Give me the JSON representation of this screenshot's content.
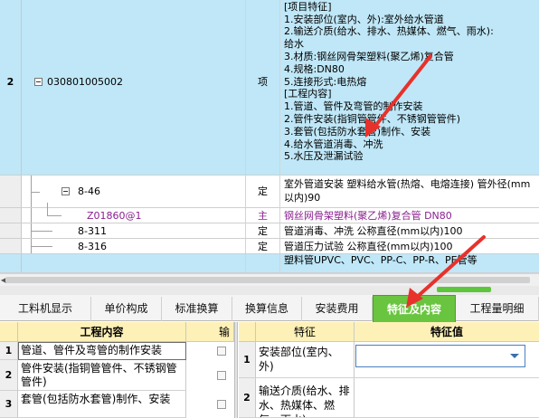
{
  "grid": {
    "main_row": {
      "num": "2",
      "code": "030801005002",
      "unit": "项",
      "desc_lines": [
        "塑料管UPVC、PVC、PP-C、PP-R、PE管等",
        "[项目特征]",
        "1.安装部位(室内、外):室外给水管道",
        "2.输送介质(给水、排水、热媒体、燃气、雨水):",
        "给水",
        "3.材质:钢丝网骨架塑料(聚乙烯)复合管",
        "4.规格:DN80",
        "5.连接形式:电热熔",
        "[工程内容]",
        "1.管道、管件及弯管的制作安装",
        "2.管件安装(指铜管管件、不锈钢管管件)",
        "3.套管(包括防水套管)制作、安装",
        "4.给水管道消毒、冲洗",
        "5.水压及泄漏试验"
      ]
    },
    "sub_rows": [
      {
        "code": "8-46",
        "unit": "定",
        "desc": "室外管道安装 塑料给水管(热熔、电熔连接) 管外径(mm以内)90",
        "style": "normal"
      },
      {
        "code": "Z01860@1",
        "unit": "主",
        "desc": "钢丝网骨架塑料(聚乙烯)复合管 DN80",
        "style": "purple"
      },
      {
        "code": "8-311",
        "unit": "定",
        "desc": "管道消毒、冲洗 公称直径(mm以内)100",
        "style": "normal"
      },
      {
        "code": "8-316",
        "unit": "定",
        "desc": "管道压力试验 公称直径(mm以内)100",
        "style": "normal"
      }
    ],
    "next_row": {
      "desc": "塑料管UPVC、PVC、PP-C、PP-R、PE管等"
    }
  },
  "tabs": [
    {
      "label": "工料机显示",
      "active": false
    },
    {
      "label": "单价构成",
      "active": false
    },
    {
      "label": "标准换算",
      "active": false
    },
    {
      "label": "换算信息",
      "active": false
    },
    {
      "label": "安装费用",
      "active": false
    },
    {
      "label": "特征及内容",
      "active": true
    },
    {
      "label": "工程量明细",
      "active": false
    }
  ],
  "left_panel": {
    "header": "工程内容",
    "header2": "输",
    "rows": [
      {
        "num": "1",
        "text": "管道、管件及弯管的制作安装"
      },
      {
        "num": "2",
        "text": "管件安装(指铜管管件、不锈钢管管件)"
      },
      {
        "num": "3",
        "text": "套管(包括防水套管)制作、安装"
      }
    ]
  },
  "right_panel": {
    "header_feature": "特征",
    "header_value": "特征值",
    "rows": [
      {
        "num": "1",
        "name": "安装部位(室内、外)"
      },
      {
        "num": "2",
        "name": "输送介质(给水、排水、热媒体、燃气、雨水)"
      }
    ]
  },
  "colors": {
    "highlight_row": "#bfe7f7",
    "active_tab": "#69c43f",
    "panel_header": "#fdf1b8",
    "annotation_arrow": "#e8312b",
    "material_text": "#8a1f8f"
  }
}
